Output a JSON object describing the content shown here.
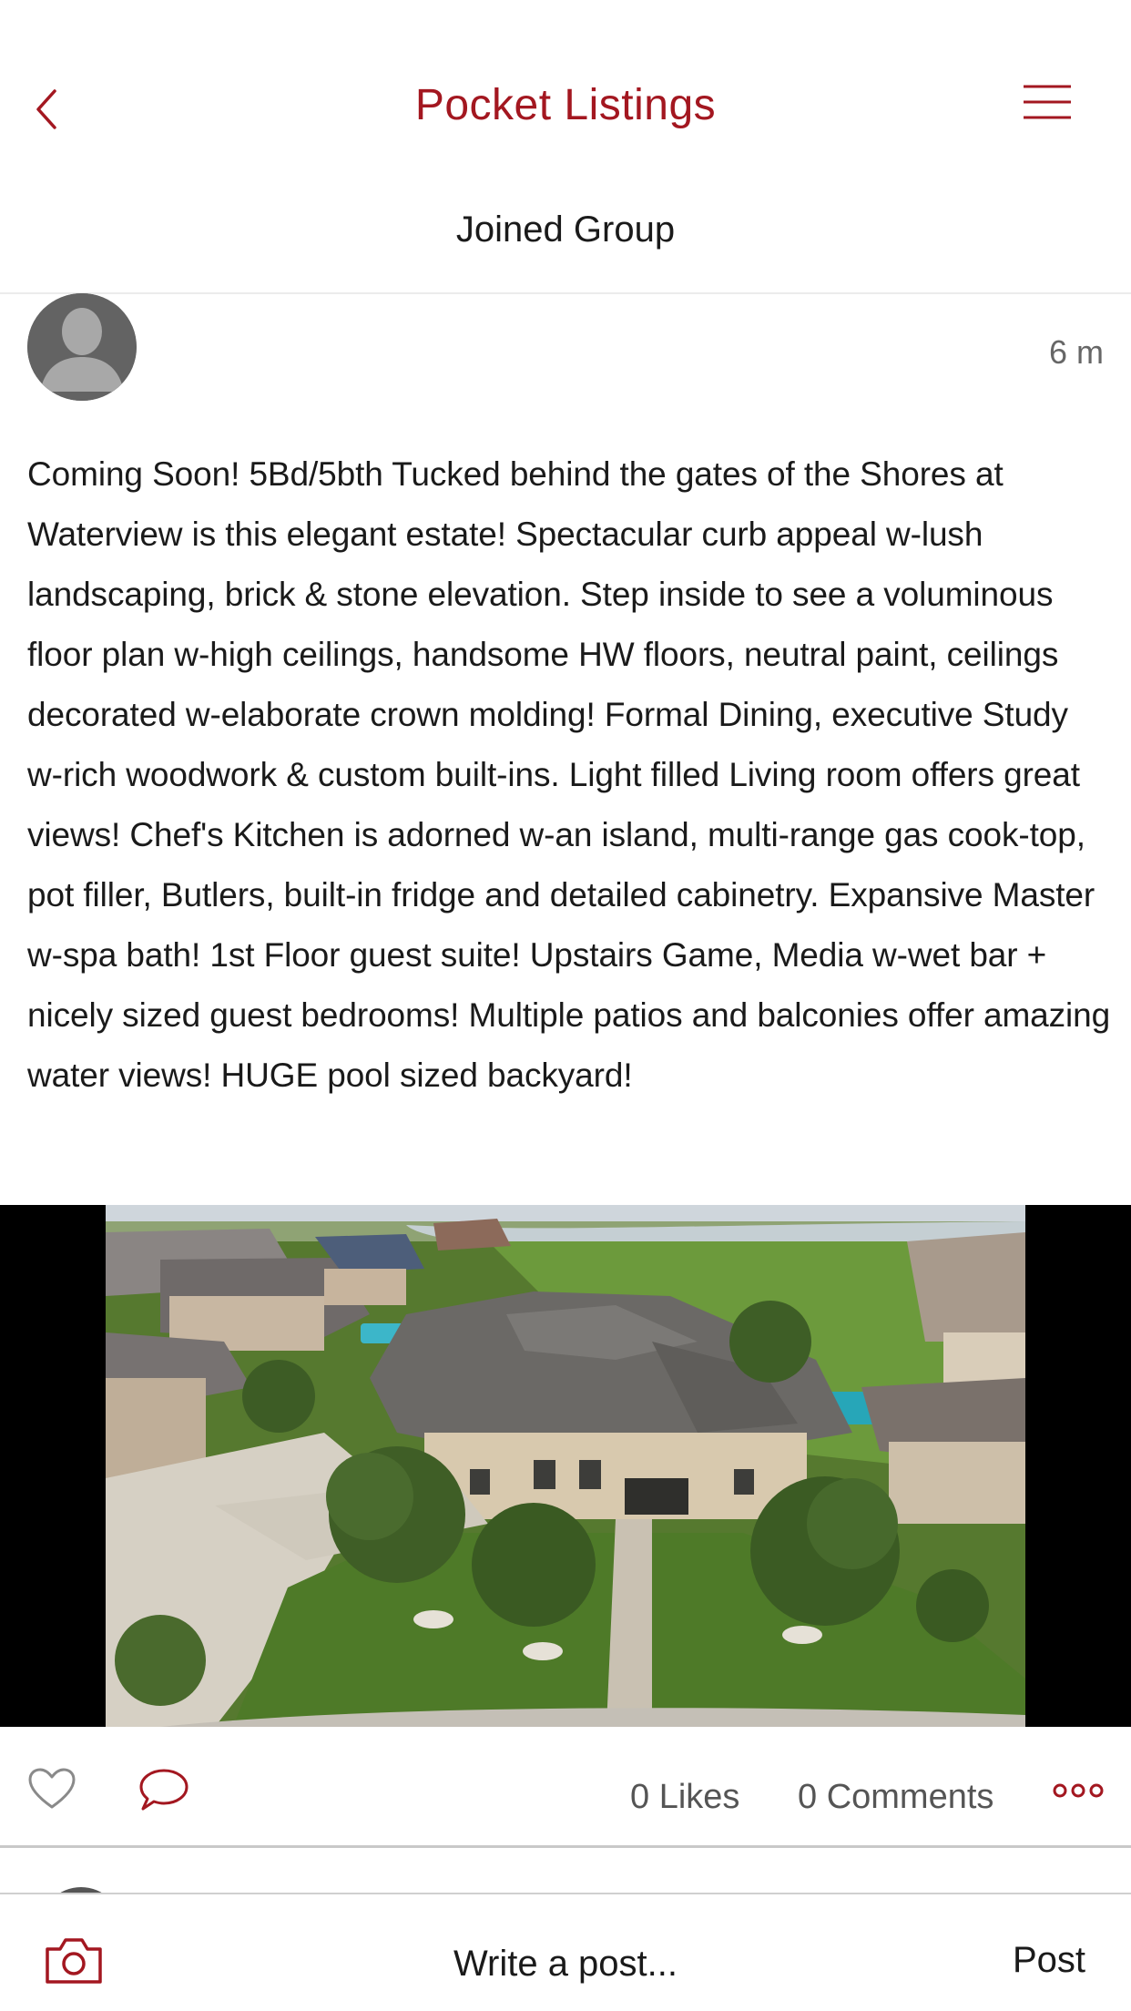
{
  "nav": {
    "back_icon": "chevron-left-icon",
    "title": "Pocket Listings",
    "menu_icon": "hamburger-menu-icon"
  },
  "group_status": "Joined Group",
  "post": {
    "avatar": "default-user-avatar",
    "time": "6 m",
    "body": "Coming Soon! 5Bd/5bth Tucked behind the gates of the Shores at Waterview is this elegant estate! Spectacular curb appeal w-lush landscaping, brick & stone elevation. Step inside to see a voluminous floor plan w-high ceilings, handsome HW floors, neutral paint, ceilings decorated w-elaborate crown molding! Formal Dining, executive Study w-rich woodwork & custom built-ins. Light filled Living room offers great views! Chef's Kitchen is adorned w-an island, multi-range gas cook-top, pot filler, Butlers, built-in fridge and detailed cabinetry. Expansive Master w-spa bath! 1st Floor guest suite! Upstairs Game, Media w-wet bar + nicely sized guest bedrooms! Multiple patios and balconies offer amazing water views! HUGE pool sized backyard!",
    "photo": "aerial-house-photo",
    "likes": "0 Likes",
    "comments": "0 Comments",
    "like_icon": "heart-icon",
    "comment_icon": "speech-bubble-icon",
    "more_icon": "more-dots-icon"
  },
  "composer": {
    "camera_icon": "camera-icon",
    "placeholder": "Write a post...",
    "post_label": "Post"
  },
  "colors": {
    "accent": "#a31720",
    "text": "#1a1a1a",
    "muted": "#555555"
  }
}
